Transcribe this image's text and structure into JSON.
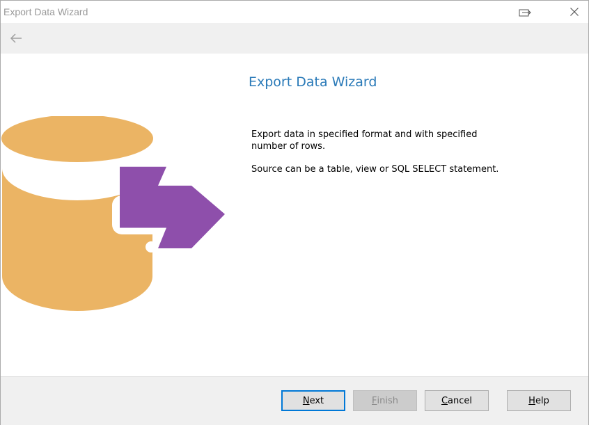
{
  "window": {
    "title": "Export Data Wizard",
    "title_icons": [
      "restore-icon",
      "close-icon"
    ]
  },
  "nav": {
    "back_icon": "back-arrow-icon"
  },
  "main": {
    "heading": "Export Data Wizard",
    "description_1": "Export data in specified format and with specified number of rows.",
    "description_2": "Source can be a table, view or SQL SELECT statement.",
    "illustration": "database-export-illustration",
    "colors": {
      "database": "#ebb464",
      "arrow": "#8e4fab",
      "heading": "#2a7ab8"
    }
  },
  "footer": {
    "next": {
      "mnemonic": "N",
      "rest": "ext"
    },
    "finish": {
      "mnemonic": "F",
      "rest": "inish"
    },
    "cancel": {
      "mnemonic": "C",
      "rest": "ancel"
    },
    "help": {
      "mnemonic": "H",
      "rest": "elp"
    }
  }
}
